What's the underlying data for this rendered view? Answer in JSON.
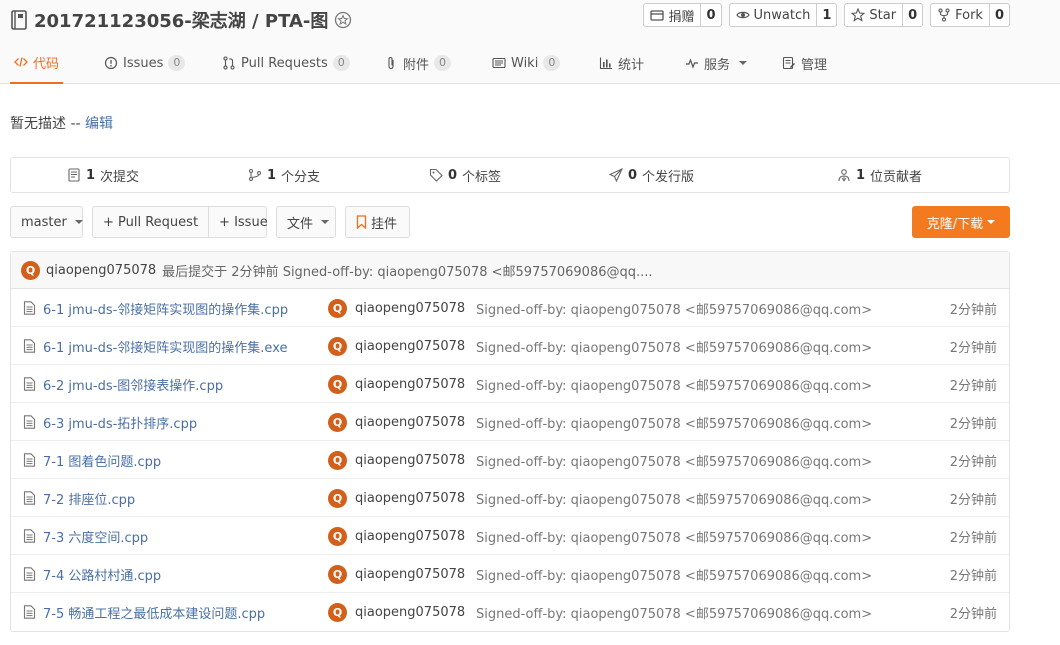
{
  "repo": {
    "title": "201721123056-梁志湖 / PTA-图"
  },
  "actions": [
    {
      "label": "捐赠",
      "count": "0"
    },
    {
      "label": "Unwatch",
      "count": "1"
    },
    {
      "label": "Star",
      "count": "0"
    },
    {
      "label": "Fork",
      "count": "0"
    }
  ],
  "tabs": [
    {
      "label": "代码",
      "count": ""
    },
    {
      "label": "Issues",
      "count": "0"
    },
    {
      "label": "Pull Requests",
      "count": "0"
    },
    {
      "label": "附件",
      "count": "0"
    },
    {
      "label": "Wiki",
      "count": "0"
    },
    {
      "label": "统计",
      "count": ""
    },
    {
      "label": "服务",
      "count": ""
    },
    {
      "label": "管理",
      "count": ""
    }
  ],
  "description": {
    "text": "暂无描述 -- ",
    "edit": "编辑"
  },
  "stats": [
    {
      "num": "1",
      "label": "次提交"
    },
    {
      "num": "1",
      "label": "个分支"
    },
    {
      "num": "0",
      "label": "个标签"
    },
    {
      "num": "0",
      "label": "个发行版"
    },
    {
      "num": "1",
      "label": "位贡献者"
    }
  ],
  "toolbar": {
    "branch": "master",
    "pull_request": "+ Pull Request",
    "issue": "+ Issue",
    "files": "文件",
    "widget": "挂件",
    "clone": "克隆/下载"
  },
  "last_commit": {
    "avatar": "Q",
    "author": "qiaopeng075078",
    "text": "最后提交于 2分钟前 Signed-off-by: qiaopeng075078 <邮59757069086@qq...."
  },
  "files": [
    {
      "name": "6-1 jmu-ds-邻接矩阵实现图的操作集.cpp",
      "user": "qiaopeng075078",
      "message": "Signed-off-by: qiaopeng075078 <邮59757069086@qq.com>",
      "time": "2分钟前"
    },
    {
      "name": "6-1 jmu-ds-邻接矩阵实现图的操作集.exe",
      "user": "qiaopeng075078",
      "message": "Signed-off-by: qiaopeng075078 <邮59757069086@qq.com>",
      "time": "2分钟前"
    },
    {
      "name": "6-2 jmu-ds-图邻接表操作.cpp",
      "user": "qiaopeng075078",
      "message": "Signed-off-by: qiaopeng075078 <邮59757069086@qq.com>",
      "time": "2分钟前"
    },
    {
      "name": "6-3 jmu-ds-拓扑排序.cpp",
      "user": "qiaopeng075078",
      "message": "Signed-off-by: qiaopeng075078 <邮59757069086@qq.com>",
      "time": "2分钟前"
    },
    {
      "name": "7-1 图着色问题.cpp",
      "user": "qiaopeng075078",
      "message": "Signed-off-by: qiaopeng075078 <邮59757069086@qq.com>",
      "time": "2分钟前"
    },
    {
      "name": "7-2 排座位.cpp",
      "user": "qiaopeng075078",
      "message": "Signed-off-by: qiaopeng075078 <邮59757069086@qq.com>",
      "time": "2分钟前"
    },
    {
      "name": "7-3 六度空间.cpp",
      "user": "qiaopeng075078",
      "message": "Signed-off-by: qiaopeng075078 <邮59757069086@qq.com>",
      "time": "2分钟前"
    },
    {
      "name": "7-4 公路村村通.cpp",
      "user": "qiaopeng075078",
      "message": "Signed-off-by: qiaopeng075078 <邮59757069086@qq.com>",
      "time": "2分钟前"
    },
    {
      "name": "7-5 畅通工程之最低成本建设问题.cpp",
      "user": "qiaopeng075078",
      "message": "Signed-off-by: qiaopeng075078 <邮59757069086@qq.com>",
      "time": "2分钟前"
    }
  ],
  "colors": {
    "accent": "#f06e1e",
    "link": "#4a6fa5",
    "avatar": "#d2601a",
    "clone_button": "#f47a20"
  }
}
